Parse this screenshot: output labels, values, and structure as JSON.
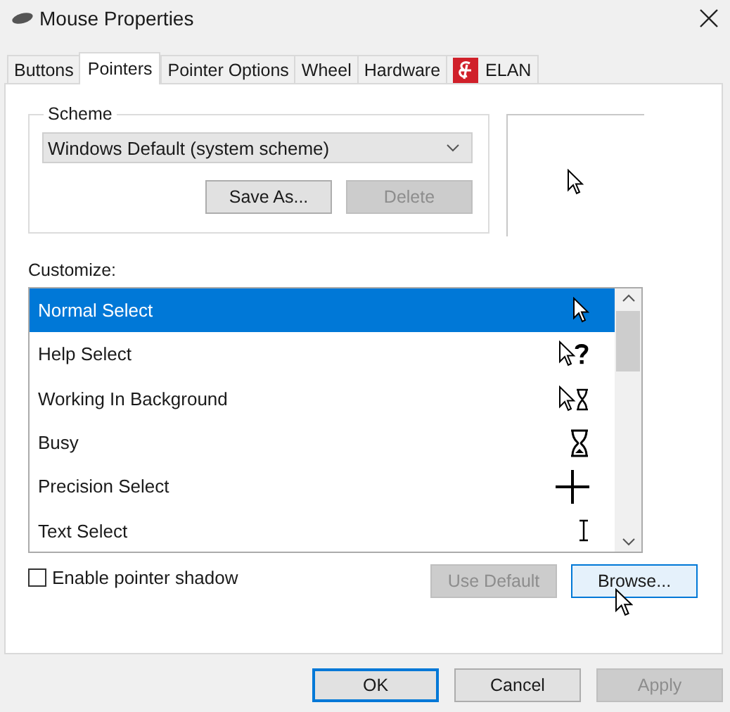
{
  "window": {
    "title": "Mouse Properties"
  },
  "tabs": [
    {
      "label": "Buttons",
      "selected": false,
      "kind": "text"
    },
    {
      "label": "Pointers",
      "selected": true,
      "kind": "text"
    },
    {
      "label": "Pointer Options",
      "selected": false,
      "kind": "text"
    },
    {
      "label": "Wheel",
      "selected": false,
      "kind": "text"
    },
    {
      "label": "Hardware",
      "selected": false,
      "kind": "text"
    },
    {
      "label": "ELAN",
      "selected": false,
      "kind": "logo"
    }
  ],
  "scheme": {
    "label": "Scheme",
    "value": "Windows Default (system scheme)",
    "buttons": [
      {
        "label": "Save As...",
        "disabled": false
      },
      {
        "label": "Delete",
        "disabled": true
      }
    ]
  },
  "customize": {
    "label": "Customize:",
    "items": [
      {
        "name": "Normal Select",
        "kind": "arrow",
        "selected": true
      },
      {
        "name": "Help Select",
        "kind": "help",
        "selected": false
      },
      {
        "name": "Working In Background",
        "kind": "working",
        "selected": false
      },
      {
        "name": "Busy",
        "kind": "busy",
        "selected": false
      },
      {
        "name": "Precision Select",
        "kind": "cross",
        "selected": false
      },
      {
        "name": "Text Select",
        "kind": "text",
        "selected": false
      }
    ]
  },
  "pointer_shadow": {
    "label": "Enable pointer shadow",
    "checked": false
  },
  "list_buttons": [
    {
      "label": "Use Default",
      "disabled": true,
      "hovered": false
    },
    {
      "label": "Browse...",
      "disabled": false,
      "hovered": true
    }
  ],
  "dialog_buttons": [
    {
      "label": "OK",
      "disabled": false,
      "default": true
    },
    {
      "label": "Cancel",
      "disabled": false,
      "default": false
    },
    {
      "label": "Apply",
      "disabled": true,
      "default": false
    }
  ]
}
